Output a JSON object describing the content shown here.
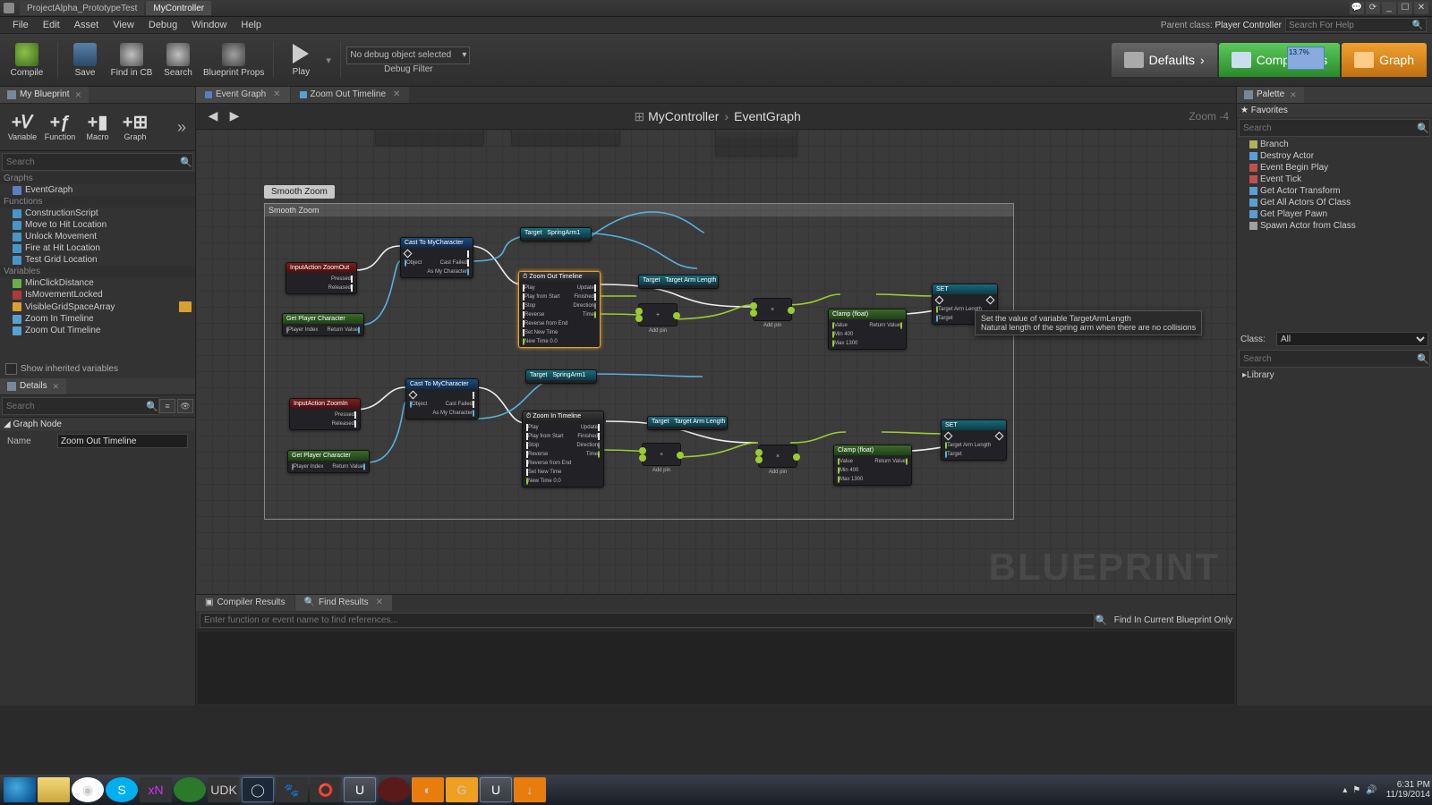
{
  "window": {
    "tabs": [
      "ProjectAlpha_PrototypeTest",
      "MyController"
    ],
    "active_tab": 1,
    "controls": {
      "min": "_",
      "max": "☐",
      "close": "✕",
      "help": "?"
    }
  },
  "menu": {
    "items": [
      "File",
      "Edit",
      "Asset",
      "View",
      "Debug",
      "Window",
      "Help"
    ],
    "parent_class_label": "Parent class:",
    "parent_class_value": "Player Controller",
    "help_search_placeholder": "Search For Help"
  },
  "toolbar": {
    "compile": "Compile",
    "save": "Save",
    "find_in_cb": "Find in CB",
    "search": "Search",
    "blueprint_props": "Blueprint Props",
    "play": "Play",
    "debug_object": "No debug object selected",
    "debug_filter_label": "Debug Filter",
    "tabs": {
      "defaults": "Defaults",
      "components": "Components",
      "graph": "Graph"
    },
    "stat": "13.7%"
  },
  "my_blueprint": {
    "title": "My Blueprint",
    "buttons": {
      "variable": "Variable",
      "function": "Function",
      "macro": "Macro",
      "graph": "Graph"
    },
    "search_placeholder": "Search",
    "sections": {
      "graphs": "Graphs",
      "functions": "Functions",
      "variables": "Variables"
    },
    "graphs": [
      "EventGraph"
    ],
    "functions": [
      "ConstructionScript",
      "Move to Hit Location",
      "Unlock Movement",
      "Fire at Hit Location",
      "Test Grid Location"
    ],
    "variables": [
      {
        "name": "MinClickDistance",
        "type": "float"
      },
      {
        "name": "IsMovementLocked",
        "type": "bool"
      },
      {
        "name": "VisibleGridSpaceArray",
        "type": "array",
        "edited": true
      }
    ],
    "timelines": [
      "Zoom In Timeline",
      "Zoom Out Timeline"
    ],
    "show_inherited": "Show inherited variables"
  },
  "details": {
    "title": "Details",
    "search_placeholder": "Search",
    "category": "Graph Node",
    "prop_name_label": "Name",
    "prop_name_value": "Zoom Out Timeline"
  },
  "graph": {
    "tabs": [
      "Event Graph",
      "Zoom Out Timeline"
    ],
    "active_tab": 0,
    "breadcrumb": [
      "MyController",
      "EventGraph"
    ],
    "zoom_label": "Zoom -4",
    "watermark": "BLUEPRINT",
    "comment_label": "Smooth Zoom",
    "comment_header": "Smooth Zoom",
    "nodes": {
      "input_out": "InputAction ZoomOut",
      "input_in": "InputAction ZoomIn",
      "cast": "Cast To MyCharacter",
      "get_player": "Get Player Character",
      "tl_out": "Zoom Out Timeline",
      "tl_in": "Zoom In Timeline",
      "spring": "SpringArm1",
      "target_arm": "Target Arm Length",
      "clamp": "Clamp (float)",
      "set": "SET",
      "addpin": "Add pin",
      "pins": {
        "pressed": "Pressed",
        "released": "Released",
        "object": "Object",
        "cast_failed": "Cast Failed",
        "as_my": "As My Character",
        "player_index": "Player Index",
        "return_value": "Return Value",
        "play": "Play",
        "play_from_start": "Play from Start",
        "stop": "Stop",
        "reverse": "Reverse",
        "reverse_from_end": "Reverse from End",
        "set_new_time": "Set New Time",
        "new_time": "New Time",
        "update": "Update",
        "finished": "Finished",
        "direction": "Direction",
        "time": "Time",
        "target": "Target",
        "value": "Value",
        "min": "Min",
        "max": "Max",
        "min_val": "400",
        "max_val": "1300",
        "new_time_val": "0.0"
      }
    },
    "tooltip": {
      "line1": "Set the value of variable TargetArmLength",
      "line2": "Natural length of the spring arm when there are no collisions"
    }
  },
  "bottom": {
    "tabs": {
      "compiler": "Compiler Results",
      "find": "Find Results"
    },
    "find_placeholder": "Enter function or event name to find references...",
    "find_current_only": "Find In Current Blueprint Only"
  },
  "palette": {
    "title": "Palette",
    "favorites_label": "Favorites",
    "search_placeholder": "Search",
    "favorites": [
      "Branch",
      "Destroy Actor",
      "Event Begin Play",
      "Event Tick",
      "Get Actor Transform",
      "Get All Actors Of Class",
      "Get Player Pawn",
      "Spawn Actor from Class"
    ],
    "class_label": "Class:",
    "class_value": "All",
    "library_label": "Library"
  },
  "taskbar": {
    "time": "6:31 PM",
    "date": "11/19/2014"
  }
}
